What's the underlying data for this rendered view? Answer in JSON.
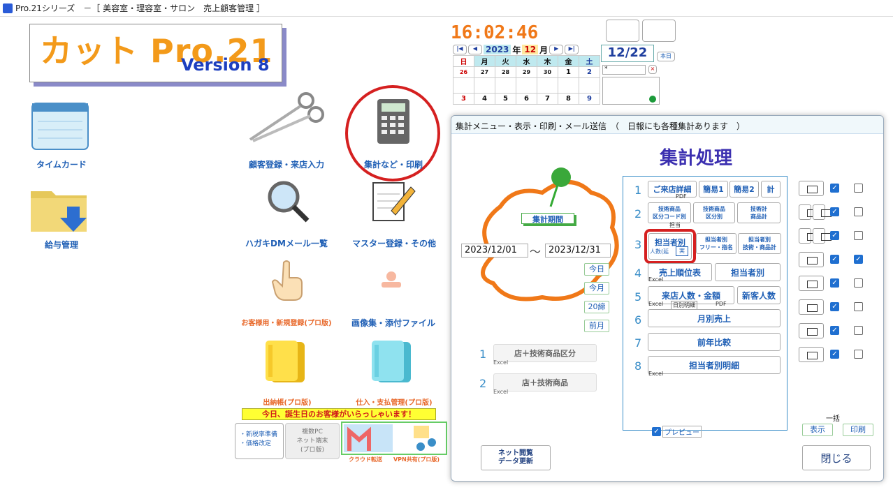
{
  "window": {
    "title": "Pro.21シリーズ　－［ 美容室・理容室・サロン　売上顧客管理 ］"
  },
  "logo": {
    "line1": "カット Pro.21",
    "version": "Version",
    "version_num": "8"
  },
  "icons": {
    "timecard": "タイムカード",
    "salary": "給与管理",
    "customer": "顧客登録・来店入力",
    "stats": "集計など・印刷",
    "dm": "ハガキDMメール一覧",
    "master": "マスター登録・その他",
    "customer_new": "お客様用・新規登録(プロ版)",
    "images": "画像集・添付ファイル",
    "ledger": "出納帳(プロ版)",
    "purchase": "仕入・支払管理(プロ版)"
  },
  "birthday_banner": "今日、誕生日のお客様がいらっしゃいます！",
  "misc": {
    "tax1": "・新税率準備",
    "tax2": "・価格改定",
    "multi1": "複数PC",
    "multi2": "ネット端末",
    "multi3": "(プロ版)",
    "cloud": "クラウド転送",
    "vpn": "VPN共有(プロ版)"
  },
  "clock": "16:02:46",
  "calendar": {
    "year": "2023",
    "year_label": "年",
    "month": "12",
    "month_label": "月",
    "date_box": "12/22",
    "today_btn": "本日",
    "days": [
      "日",
      "月",
      "火",
      "水",
      "木",
      "金",
      "土"
    ],
    "rows": [
      [
        "26",
        "27",
        "28",
        "29",
        "30",
        "1",
        "2"
      ],
      [
        "3",
        "4",
        "5",
        "6",
        "7",
        "8",
        "9"
      ]
    ],
    "memo": "*"
  },
  "dialog": {
    "title": "集計メニュー・表示・印刷・メール送信　（　日報にも各種集計あります　）",
    "heading": "集計処理",
    "period_label": "集計期間",
    "date_from": "2023/12/01",
    "tilde": "～",
    "date_to": "2023/12/31",
    "quick": [
      "今日",
      "今月",
      "20締",
      "前月"
    ],
    "left_items": [
      {
        "n": "1",
        "label": "店＋技術商品区分",
        "excel": "Excel"
      },
      {
        "n": "2",
        "label": "店＋技術商品",
        "excel": "Excel"
      }
    ],
    "rows": [
      {
        "n": "1",
        "b": [
          "ご来店詳細",
          "簡易1",
          "簡易2",
          "計"
        ],
        "sub": "PDF"
      },
      {
        "n": "2",
        "b": [
          "技術商品\n区分コード別",
          "技術商品\n区分別",
          "技術計\n商品計"
        ],
        "sub": "担当"
      },
      {
        "n": "3",
        "b": [
          "担当者別",
          "担当者別\nフリー・指名",
          "担当者別\n技術・商品計"
        ],
        "sub": "人数(延",
        "sub2": "実"
      },
      {
        "n": "4",
        "b": [
          "売上順位表",
          "担当者別"
        ],
        "sub": "Excel"
      },
      {
        "n": "5",
        "b": [
          "来店人数・金額",
          "新客人数"
        ],
        "sub": "Excel",
        "sub2": "日別明細",
        "sub3": "PDF"
      },
      {
        "n": "6",
        "b": [
          "月別売上"
        ]
      },
      {
        "n": "7",
        "b": [
          "前年比較"
        ]
      },
      {
        "n": "8",
        "b": [
          "担当者別明細"
        ],
        "sub": "Excel"
      }
    ],
    "preview": "プレビュー",
    "bulk": "一括",
    "show": "表示",
    "print": "印刷",
    "net_btn": "ネット閲覧\nデータ更新",
    "close": "閉じる"
  }
}
